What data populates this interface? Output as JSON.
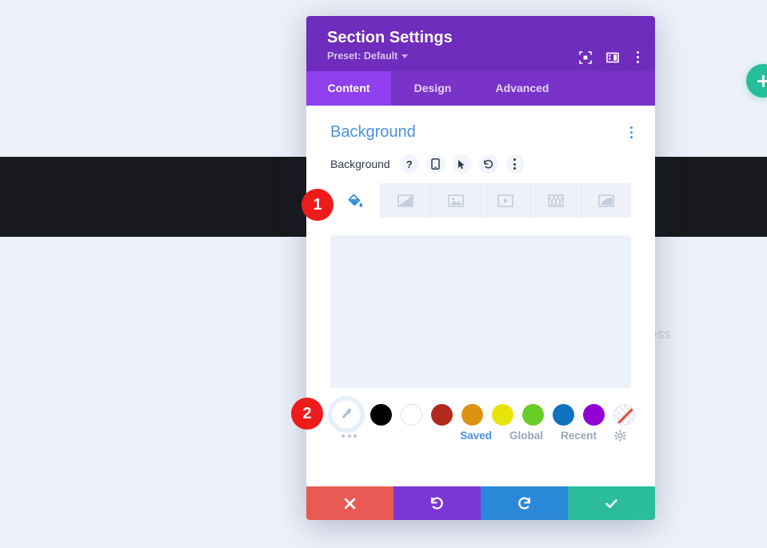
{
  "backdrop": {
    "partial_text": "ess",
    "add_button_icon": "plus-icon"
  },
  "modal": {
    "title": "Section Settings",
    "preset_label": "Preset: Default",
    "header_icons": [
      {
        "name": "focus-frame-icon"
      },
      {
        "name": "panel-layout-icon"
      },
      {
        "name": "more-vertical-icon"
      }
    ],
    "tabs": [
      {
        "label": "Content",
        "active": true
      },
      {
        "label": "Design",
        "active": false
      },
      {
        "label": "Advanced",
        "active": false
      }
    ]
  },
  "section": {
    "title": "Background",
    "menu_icon": "more-vertical-icon",
    "field_label": "Background",
    "field_icons": [
      {
        "name": "help-icon",
        "glyph": "?"
      },
      {
        "name": "responsive-mobile-icon"
      },
      {
        "name": "hover-cursor-icon"
      },
      {
        "name": "reset-undo-icon"
      },
      {
        "name": "more-vertical-icon"
      }
    ],
    "bg_types": [
      {
        "name": "background-color-tab",
        "icon": "paint-bucket-icon",
        "active": true
      },
      {
        "name": "background-gradient-tab",
        "icon": "gradient-icon",
        "active": false
      },
      {
        "name": "background-image-tab",
        "icon": "image-icon",
        "active": false
      },
      {
        "name": "background-video-tab",
        "icon": "video-icon",
        "active": false
      },
      {
        "name": "background-pattern-tab",
        "icon": "pattern-icon",
        "active": false
      },
      {
        "name": "background-mask-tab",
        "icon": "mask-icon",
        "active": false
      }
    ]
  },
  "palette": {
    "eyedropper_icon": "eyedropper-icon",
    "more_icon": "more-horizontal-icon",
    "swatches": [
      {
        "name": "swatch-black",
        "color": "#000000"
      },
      {
        "name": "swatch-white",
        "color": "#ffffff"
      },
      {
        "name": "swatch-dark-red",
        "color": "#b2291d"
      },
      {
        "name": "swatch-orange",
        "color": "#dd9210"
      },
      {
        "name": "swatch-yellow",
        "color": "#e8e40a"
      },
      {
        "name": "swatch-green",
        "color": "#68cd26"
      },
      {
        "name": "swatch-blue",
        "color": "#1173c0"
      },
      {
        "name": "swatch-purple",
        "color": "#9200d6"
      },
      {
        "name": "swatch-transparent",
        "color": "transparent"
      }
    ],
    "tabs": [
      {
        "label": "Saved",
        "active": true
      },
      {
        "label": "Global",
        "active": false
      },
      {
        "label": "Recent",
        "active": false
      }
    ],
    "settings_icon": "gear-icon"
  },
  "footer": {
    "actions": [
      {
        "name": "cancel-button",
        "icon": "close-icon",
        "color": "#ea5a54"
      },
      {
        "name": "undo-button",
        "icon": "undo-icon",
        "color": "#7a35d6"
      },
      {
        "name": "redo-button",
        "icon": "redo-icon",
        "color": "#2a88d8"
      },
      {
        "name": "save-button",
        "icon": "check-icon",
        "color": "#2abc9b"
      }
    ]
  },
  "callouts": [
    {
      "number": "1"
    },
    {
      "number": "2"
    }
  ]
}
